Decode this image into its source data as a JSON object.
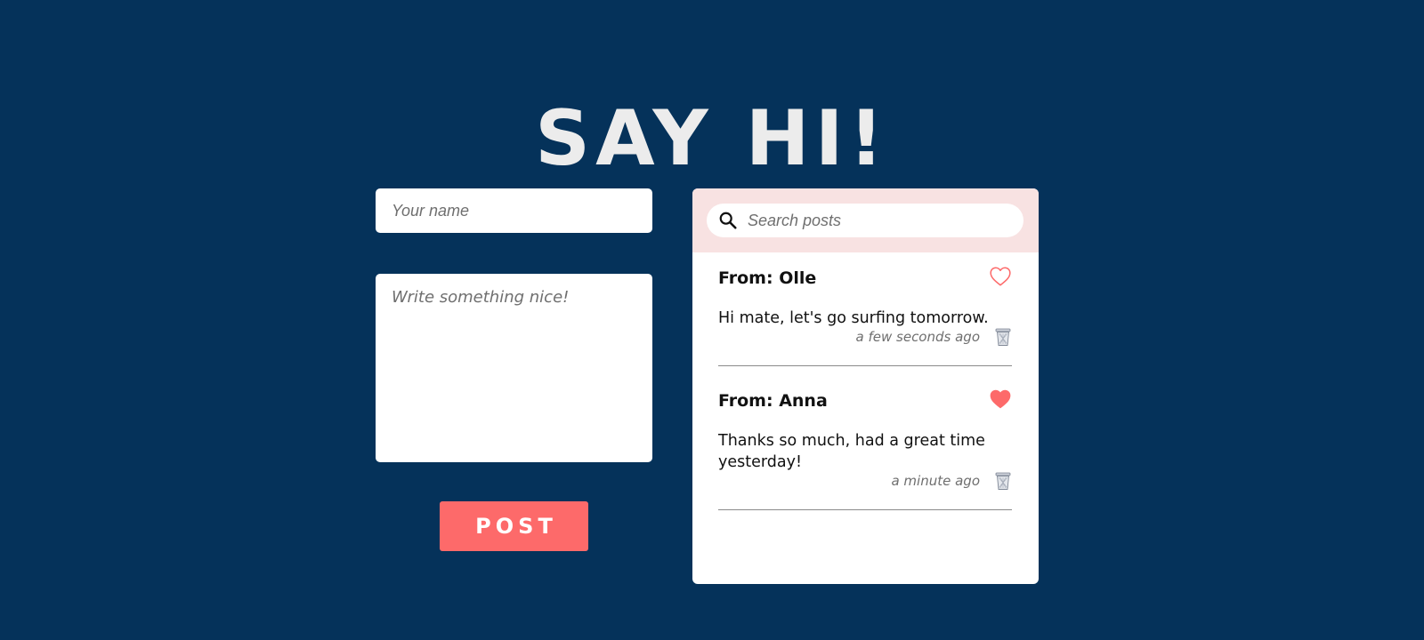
{
  "page": {
    "title": "SAY HI!"
  },
  "form": {
    "name_placeholder": "Your name",
    "message_placeholder": "Write something nice!",
    "post_label": "POST"
  },
  "search": {
    "placeholder": "Search posts"
  },
  "posts": [
    {
      "author": "From: Olle",
      "message": "Hi mate, let's go surfing tomorrow.",
      "time": "a few seconds ago",
      "liked": false
    },
    {
      "author": "From: Anna",
      "message": "Thanks so much, had a great time yesterday!",
      "time": "a minute ago",
      "liked": true
    }
  ],
  "colors": {
    "background": "#05325a",
    "title": "#ececec",
    "accent": "#fd6a6a",
    "search_bar": "#f8e2e2",
    "panel": "#ffffff"
  },
  "icons": {
    "search": "search-icon",
    "like": "heart-icon",
    "delete": "trash-icon"
  }
}
